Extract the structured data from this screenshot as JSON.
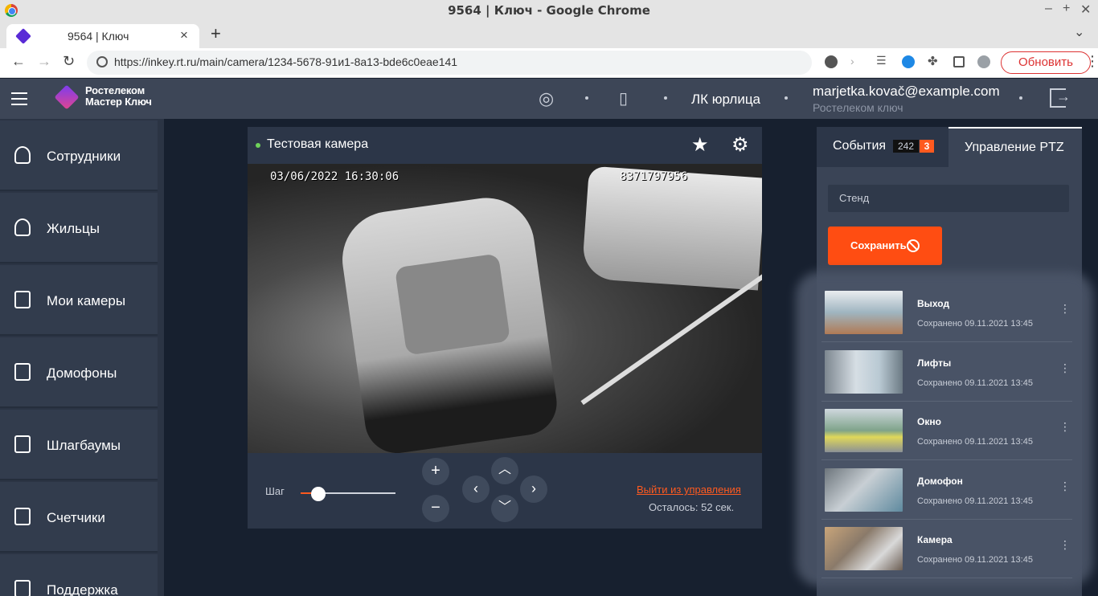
{
  "browser": {
    "window_title": "9564 | Ключ - Google Chrome",
    "tab_title": "9564 | Ключ",
    "url": "https://inkey.rt.ru/main/camera/1234-5678-91и1-8a13-bde6c0eae141",
    "update_label": "Обновить"
  },
  "header": {
    "logo_line1": "Ростелеком",
    "logo_line2": "Мастер Ключ",
    "account_type": "ЛК юрлица",
    "email": "marjetka.kovač@example.com",
    "company": "Ростелеком ключ"
  },
  "sidebar": {
    "items": [
      {
        "label": "Сотрудники",
        "icon": "user-icon"
      },
      {
        "label": "Жильцы",
        "icon": "users-icon"
      },
      {
        "label": "Мои камеры",
        "icon": "camera-icon"
      },
      {
        "label": "Домофоны",
        "icon": "door-icon"
      },
      {
        "label": "Шлагбаумы",
        "icon": "barrier-icon"
      },
      {
        "label": "Счетчики",
        "icon": "meter-icon"
      },
      {
        "label": "Поддержка",
        "icon": "support-icon"
      }
    ]
  },
  "camera": {
    "title": "Тестовая камера",
    "osd_datetime": "03/06/2022 16:30:06",
    "osd_id": "8371797956",
    "step_label": "Шаг",
    "step_value": 0.15,
    "exit_label": "Выйти из управления",
    "remaining": "Осталось: 52 сек."
  },
  "right_panel": {
    "tab_events": "События",
    "events_count": "242",
    "events_new": "3",
    "tab_ptz": "Управление PTZ",
    "preset_placeholder": "Стенд",
    "save_label": "Сохранить",
    "presets": [
      {
        "name": "Выход",
        "saved": "Сохранено 09.11.2021 13:45"
      },
      {
        "name": "Лифты",
        "saved": "Сохранено 09.11.2021 13:45"
      },
      {
        "name": "Окно",
        "saved": "Сохранено 09.11.2021 13:45"
      },
      {
        "name": "Домофон",
        "saved": "Сохранено 09.11.2021 13:45"
      },
      {
        "name": "Камера",
        "saved": "Сохранено 09.11.2021 13:45"
      }
    ]
  },
  "colors": {
    "accent": "#ff5a1f",
    "header": "#3d4657",
    "sidebar": "#323c4d",
    "background": "#17202f"
  }
}
